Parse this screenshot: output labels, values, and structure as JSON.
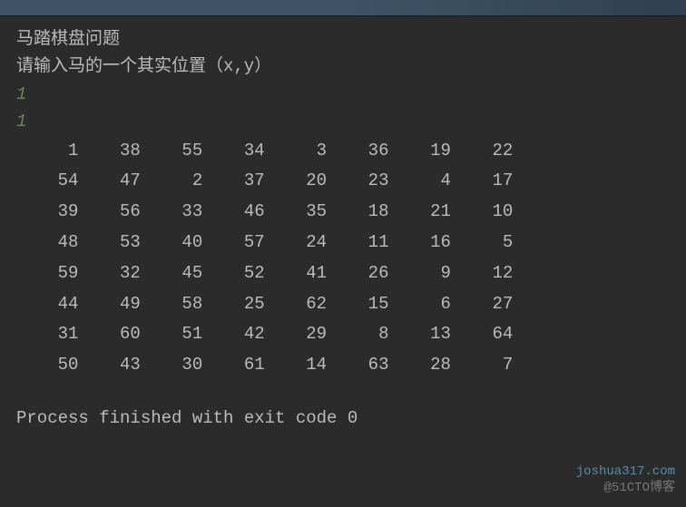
{
  "header": {
    "title": "马踏棋盘问题",
    "prompt": "请输入马的一个其实位置（x,y）"
  },
  "inputs": {
    "x": "1",
    "y": "1"
  },
  "board": [
    [
      1,
      38,
      55,
      34,
      3,
      36,
      19,
      22
    ],
    [
      54,
      47,
      2,
      37,
      20,
      23,
      4,
      17
    ],
    [
      39,
      56,
      33,
      46,
      35,
      18,
      21,
      10
    ],
    [
      48,
      53,
      40,
      57,
      24,
      11,
      16,
      5
    ],
    [
      59,
      32,
      45,
      52,
      41,
      26,
      9,
      12
    ],
    [
      44,
      49,
      58,
      25,
      62,
      15,
      6,
      27
    ],
    [
      31,
      60,
      51,
      42,
      29,
      8,
      13,
      64
    ],
    [
      50,
      43,
      30,
      61,
      14,
      63,
      28,
      7
    ]
  ],
  "exit_message": "Process finished with exit code 0",
  "watermark": {
    "site": "joshua317.com",
    "blog": "@51CTO博客"
  }
}
